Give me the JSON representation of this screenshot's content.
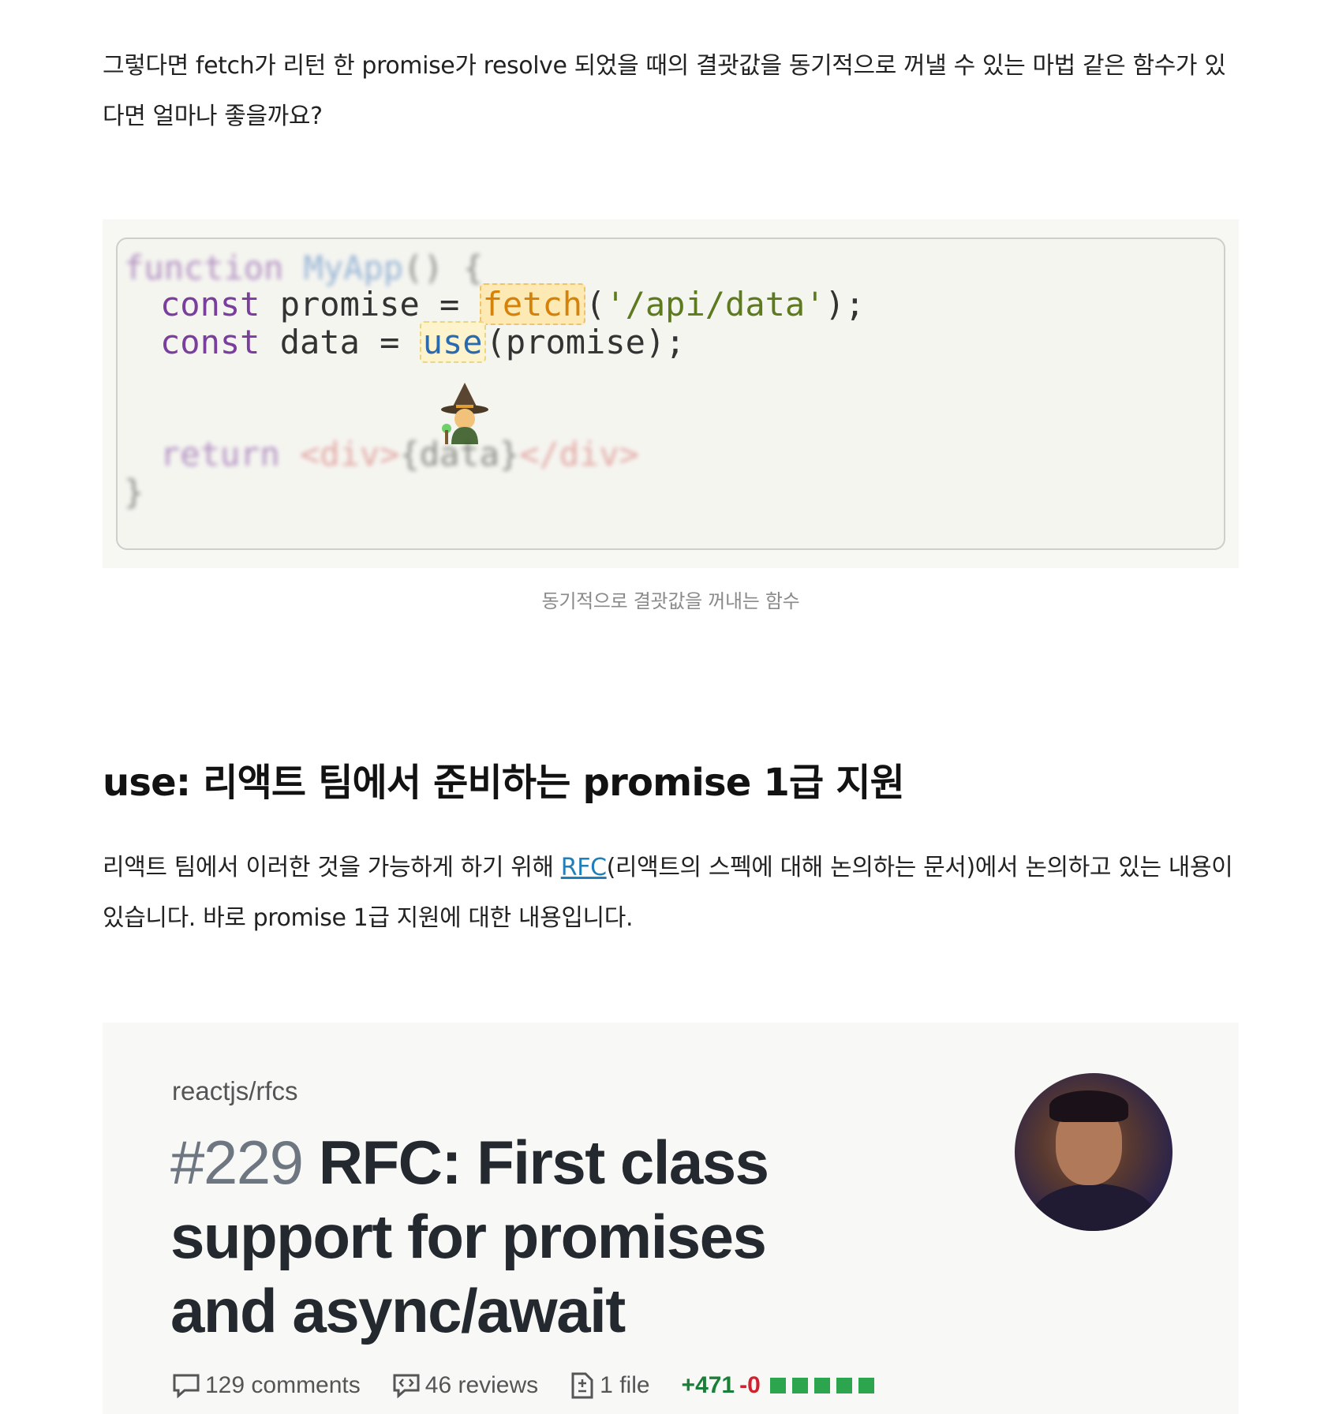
{
  "paragraph1": "그렇다면 fetch가 리턴 한 promise가 resolve 되었을 때의 결괏값을 동기적으로 꺼낼 수 있는 마법 같은 함수가 있다면 얼마나 좋을까요?",
  "code": {
    "line1_kw": "function",
    "line1_fn": "MyApp",
    "line1_rest": "() {",
    "line2_kw": "const",
    "line2_a": " promise = ",
    "line2_fetch": "fetch",
    "line2_b": "(",
    "line2_str": "'/api/data'",
    "line2_c": ");",
    "line3_kw": "const",
    "line3_a": " data = ",
    "line3_use": "use",
    "line3_b": "(promise);",
    "line4_kw": "return",
    "line4_tag": "<div>",
    "line4_mid": "{data}",
    "line4_tag2": "</div>",
    "line5": "}"
  },
  "caption": "동기적으로 결괏값을 꺼내는 함수",
  "heading": "use: 리액트 팀에서 준비하는 promise 1급 지원",
  "paragraph2": {
    "before": "리액트 팀에서 이러한 것을 가능하게 하기 위해 ",
    "link": "RFC",
    "after": "(리액트의 스펙에 대해 논의하는 문서)에서 논의하고 있는 내용이 있습니다. 바로 promise 1급 지원에 대한 내용입니다."
  },
  "rfc_card": {
    "repo": "reactjs/rfcs",
    "number": "#229",
    "title": "RFC: First class support for promises and async/await",
    "comments": "129 comments",
    "reviews": "46 reviews",
    "files": "1 file",
    "additions": "+471",
    "deletions": "-0"
  },
  "colors": {
    "link": "#1f7fb8",
    "additions": "#1a7f37",
    "deletions": "#cf222e"
  }
}
